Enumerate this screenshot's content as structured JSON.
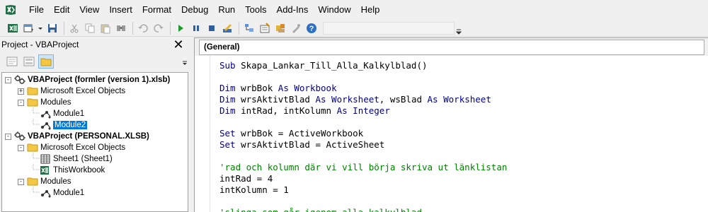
{
  "menubar": {
    "app_icon": "excel-icon",
    "items": [
      "File",
      "Edit",
      "View",
      "Insert",
      "Format",
      "Debug",
      "Run",
      "Tools",
      "Add-Ins",
      "Window",
      "Help"
    ]
  },
  "toolbar": {
    "buttons": [
      "excel-view-icon",
      "insert-userform-icon",
      "save-icon",
      "cut-icon",
      "copy-icon",
      "paste-icon",
      "find-icon",
      "undo-icon",
      "redo-icon",
      "run-icon",
      "break-icon",
      "reset-icon",
      "design-mode-icon",
      "project-explorer-icon",
      "properties-icon",
      "object-browser-icon",
      "toolbox-icon",
      "help-icon"
    ]
  },
  "project": {
    "title": "Project - VBAProject",
    "tree": [
      {
        "label": "VBAProject (formler (version 1).xlsb)",
        "level": 0,
        "expander": "−",
        "icon": "vba-project-icon",
        "bold": true
      },
      {
        "label": "Microsoft Excel Objects",
        "level": 1,
        "expander": "+",
        "icon": "folder-icon"
      },
      {
        "label": "Modules",
        "level": 1,
        "expander": "−",
        "icon": "folder-icon"
      },
      {
        "label": "Module1",
        "level": 2,
        "icon": "module-icon"
      },
      {
        "label": "Module2",
        "level": 2,
        "icon": "module-icon",
        "selected": true
      },
      {
        "label": "VBAProject (PERSONAL.XLSB)",
        "level": 0,
        "expander": "−",
        "icon": "vba-project-icon",
        "bold": true
      },
      {
        "label": "Microsoft Excel Objects",
        "level": 1,
        "expander": "−",
        "icon": "folder-icon"
      },
      {
        "label": "Sheet1 (Sheet1)",
        "level": 2,
        "icon": "sheet-icon"
      },
      {
        "label": "ThisWorkbook",
        "level": 2,
        "icon": "workbook-icon"
      },
      {
        "label": "Modules",
        "level": 1,
        "expander": "−",
        "icon": "folder-icon"
      },
      {
        "label": "Module1",
        "level": 2,
        "icon": "module-icon"
      }
    ]
  },
  "code": {
    "object_combo": "(General)",
    "lines": [
      [
        {
          "t": "Sub",
          "c": "kw"
        },
        {
          "t": " Skapa_Lankar_Till_Alla_Kalkylblad()",
          "c": "tx"
        }
      ],
      [],
      [
        {
          "t": "Dim",
          "c": "kw"
        },
        {
          "t": " wrbBok ",
          "c": "tx"
        },
        {
          "t": "As",
          "c": "kw"
        },
        {
          "t": " Workbook",
          "c": "kw"
        }
      ],
      [
        {
          "t": "Dim",
          "c": "kw"
        },
        {
          "t": " wrsAktivtBlad ",
          "c": "tx"
        },
        {
          "t": "As",
          "c": "kw"
        },
        {
          "t": " Worksheet",
          "c": "kw"
        },
        {
          "t": ", wsBlad ",
          "c": "tx"
        },
        {
          "t": "As",
          "c": "kw"
        },
        {
          "t": " Worksheet",
          "c": "kw"
        }
      ],
      [
        {
          "t": "Dim",
          "c": "kw"
        },
        {
          "t": " intRad, intKolumn ",
          "c": "tx"
        },
        {
          "t": "As",
          "c": "kw"
        },
        {
          "t": " Integer",
          "c": "kw"
        }
      ],
      [],
      [
        {
          "t": "Set",
          "c": "kw"
        },
        {
          "t": " wrbBok = ActiveWorkbook",
          "c": "tx"
        }
      ],
      [
        {
          "t": "Set",
          "c": "kw"
        },
        {
          "t": " wrsAktivtBlad = ActiveSheet",
          "c": "tx"
        }
      ],
      [],
      [
        {
          "t": "'rad och kolumn där vi vill börja skriva ut länklistan",
          "c": "cm"
        }
      ],
      [
        {
          "t": "intRad = 4",
          "c": "tx"
        }
      ],
      [
        {
          "t": "intKolumn = 1",
          "c": "tx"
        }
      ],
      [],
      [
        {
          "t": "'slinga som går igenom alla kalkylblad",
          "c": "cm"
        }
      ]
    ]
  }
}
